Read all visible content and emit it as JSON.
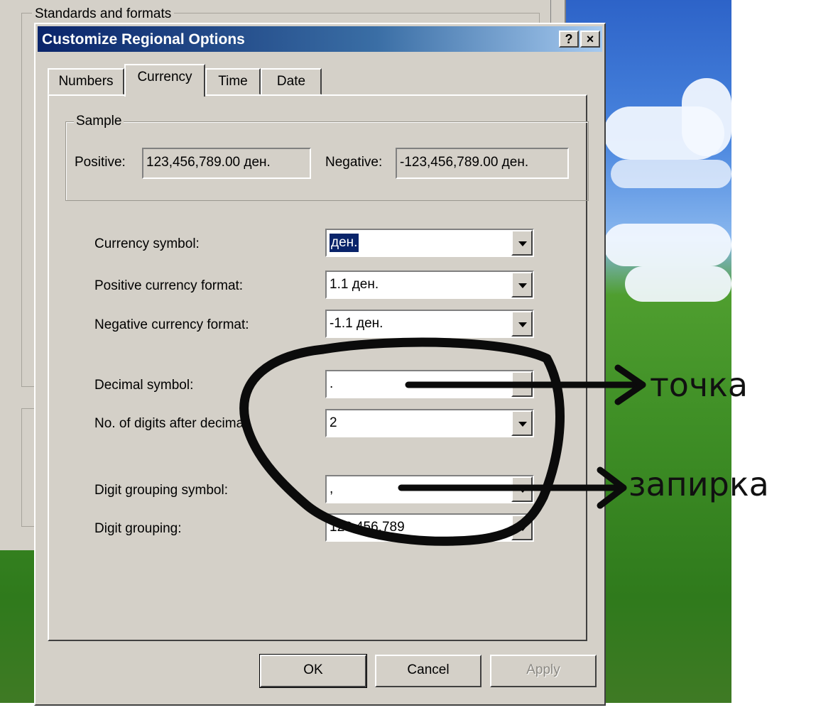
{
  "parent": {
    "group_label": "Standards and formats"
  },
  "dialog": {
    "title": "Customize Regional Options",
    "help_btn": "?",
    "close_btn": "×",
    "tabs": [
      "Numbers",
      "Currency",
      "Time",
      "Date"
    ],
    "active_tab": "Currency"
  },
  "sample": {
    "label": "Sample",
    "positive_label": "Positive:",
    "positive_value": "123,456,789.00 ден.",
    "negative_label": "Negative:",
    "negative_value": "-123,456,789.00 ден."
  },
  "fields": {
    "currency_symbol": {
      "label": "Currency symbol:",
      "value": "ден."
    },
    "positive_format": {
      "label": "Positive currency format:",
      "value": "1.1 ден."
    },
    "negative_format": {
      "label": "Negative currency format:",
      "value": "-1.1 ден."
    },
    "decimal_symbol": {
      "label": "Decimal symbol:",
      "value": "."
    },
    "digits_after_decimal": {
      "label": "No. of digits after decimal:",
      "value": "2"
    },
    "grouping_symbol": {
      "label": "Digit grouping symbol:",
      "value": ","
    },
    "digit_grouping": {
      "label": "Digit grouping:",
      "value": "123,456,789"
    }
  },
  "buttons": {
    "ok": "OK",
    "cancel": "Cancel",
    "apply": "Apply"
  },
  "annotations": {
    "decimal_note": "точка",
    "grouping_note": "запирка"
  }
}
